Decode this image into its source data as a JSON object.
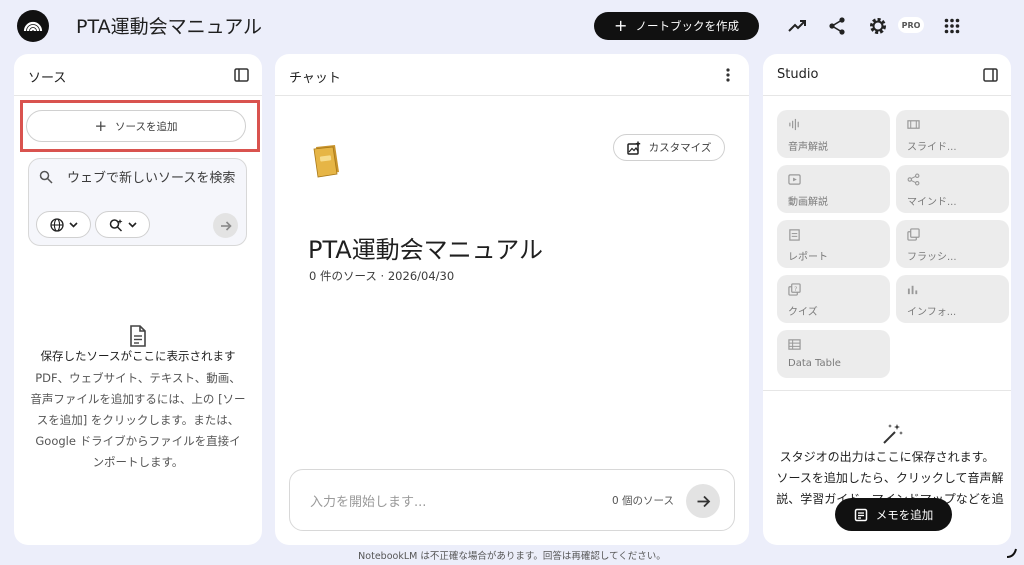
{
  "header": {
    "title": "PTA運動会マニュアル",
    "create_button": "ノートブックを作成",
    "pro_badge": "PRO",
    "icons": [
      "analytics-icon",
      "share-icon",
      "settings-icon",
      "apps-grid-icon"
    ]
  },
  "sources": {
    "title": "ソース",
    "add_button": "ソースを追加",
    "search_placeholder": "ウェブで新しいソースを検索",
    "empty_title": "保存したソースがここに表示されます",
    "empty_desc": "PDF、ウェブサイト、テキスト、動画、音声ファイルを追加するには、上の [ソースを追加] をクリックします。または、Google ドライブからファイルを直接インポートします。"
  },
  "chat": {
    "title": "チャット",
    "customize_button": "カスタマイズ",
    "notebook_title": "PTA運動会マニュアル",
    "meta": "0 件のソース · 2026/04/30",
    "input_placeholder": "入力を開始します...",
    "source_count": "0 個のソース"
  },
  "studio": {
    "title": "Studio",
    "tiles": [
      {
        "label": "音声解説",
        "icon": "audio-icon"
      },
      {
        "label": "スライド...",
        "icon": "slides-icon"
      },
      {
        "label": "動画解説",
        "icon": "video-icon"
      },
      {
        "label": "マインド...",
        "icon": "mindmap-icon"
      },
      {
        "label": "レポート",
        "icon": "report-icon"
      },
      {
        "label": "フラッシ...",
        "icon": "flashcard-icon"
      },
      {
        "label": "クイズ",
        "icon": "quiz-icon"
      },
      {
        "label": "インフォ...",
        "icon": "infographic-icon"
      },
      {
        "label": "Data Table",
        "icon": "table-icon"
      }
    ],
    "empty_title": "スタジオの出力はここに保存されます。",
    "empty_desc": "ソースを追加したら、クリックして音声解説、学習ガイド、マインドマップなどを追",
    "memo_button": "メモを追加"
  },
  "footer": {
    "note": "NotebookLM は不正確な場合があります。回答は再確認してください。"
  },
  "colors": {
    "background": "#eceefa",
    "panel": "#ffffff",
    "highlight_frame": "#d9534f",
    "dark_button": "#111111",
    "tile": "#ececec"
  }
}
